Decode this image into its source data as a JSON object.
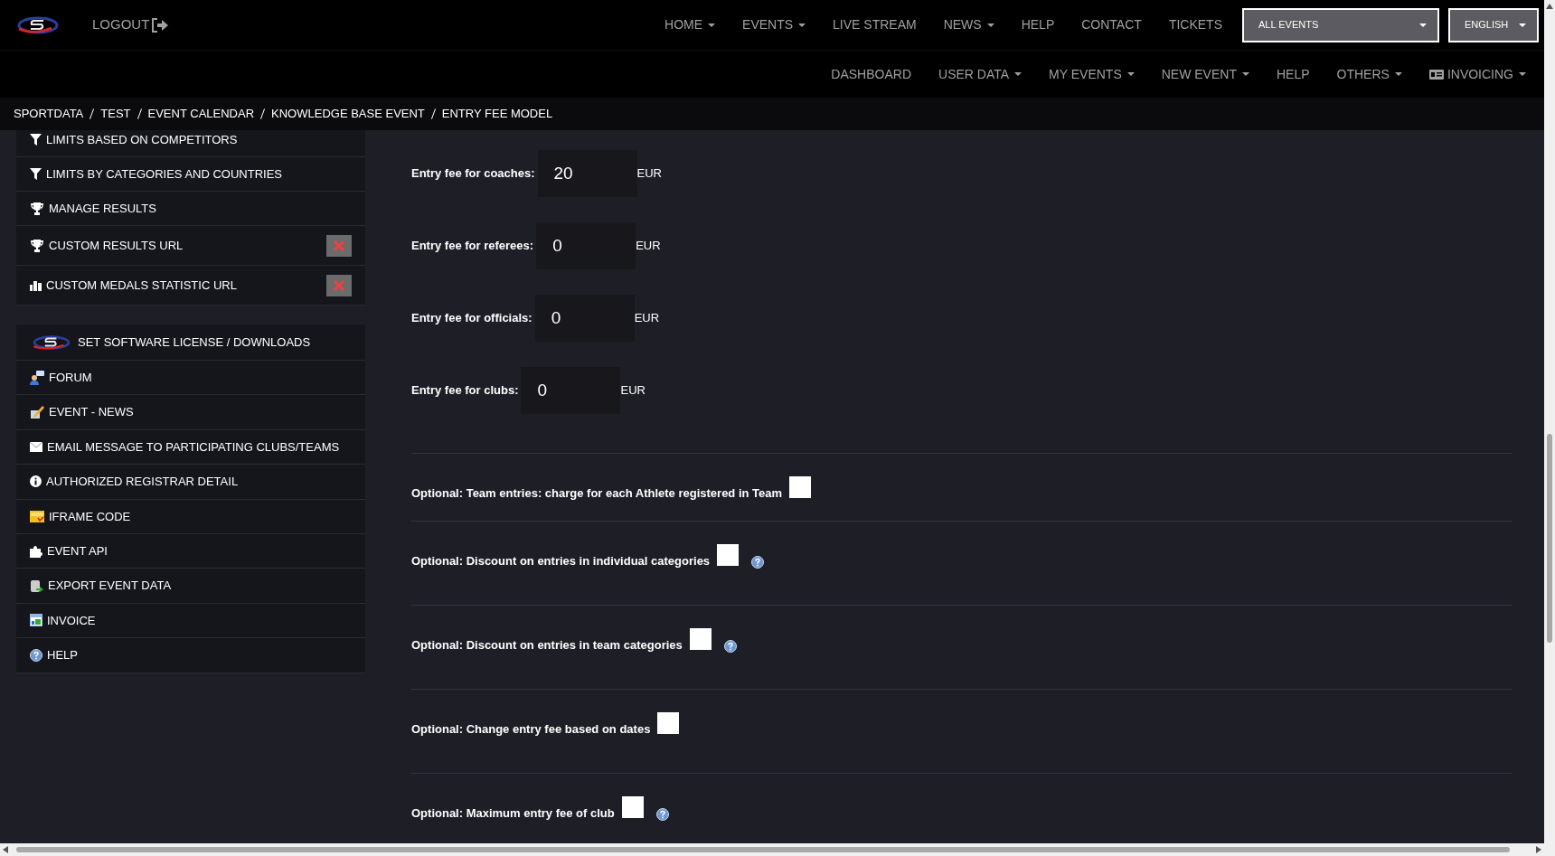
{
  "header": {
    "logout": "LOGOUT",
    "nav_primary": [
      {
        "label": "HOME",
        "dropdown": true
      },
      {
        "label": "EVENTS",
        "dropdown": true
      },
      {
        "label": "LIVE STREAM",
        "dropdown": false
      },
      {
        "label": "NEWS",
        "dropdown": true
      },
      {
        "label": "HELP",
        "dropdown": false
      },
      {
        "label": "CONTACT",
        "dropdown": false
      },
      {
        "label": "TICKETS",
        "dropdown": false
      }
    ],
    "event_select": {
      "value": "ALL EVENTS"
    },
    "language_select": {
      "value": "ENGLISH"
    },
    "nav_secondary": [
      {
        "label": "DASHBOARD",
        "dropdown": false
      },
      {
        "label": "USER DATA",
        "dropdown": true
      },
      {
        "label": "MY EVENTS",
        "dropdown": true
      },
      {
        "label": "NEW EVENT",
        "dropdown": true
      },
      {
        "label": "HELP",
        "dropdown": false
      },
      {
        "label": "OTHERS",
        "dropdown": true
      },
      {
        "label": "INVOICING",
        "dropdown": true
      }
    ]
  },
  "breadcrumb": [
    "SPORTDATA",
    "TEST",
    "EVENT CALENDAR",
    "KNOWLEDGE BASE EVENT",
    "ENTRY FEE MODEL"
  ],
  "sidebar": {
    "groups": [
      {
        "items": [
          {
            "label": "LIMITS BASED ON COMPETITORS",
            "kind": "link"
          },
          {
            "label": "LIMITS BY CATEGORIES AND COUNTRIES",
            "kind": "link"
          },
          {
            "label": "MANAGE RESULTS",
            "kind": "link"
          },
          {
            "label": "CUSTOM RESULTS URL",
            "kind": "remove"
          },
          {
            "label": "CUSTOM MEDALS STATISTIC URL",
            "kind": "remove"
          }
        ]
      },
      {
        "items": [
          {
            "label": "SET SOFTWARE LICENSE / DOWNLOADS",
            "kind": "link"
          },
          {
            "label": "FORUM",
            "kind": "link"
          },
          {
            "label": "EVENT - NEWS",
            "kind": "link"
          },
          {
            "label": "EMAIL MESSAGE TO PARTICIPATING CLUBS/TEAMS",
            "kind": "link"
          },
          {
            "label": "AUTHORIZED REGISTRAR DETAIL",
            "kind": "link"
          },
          {
            "label": "IFRAME CODE",
            "kind": "link"
          },
          {
            "label": "EVENT API",
            "kind": "link"
          },
          {
            "label": "EXPORT EVENT DATA",
            "kind": "link"
          },
          {
            "label": "INVOICE",
            "kind": "link"
          },
          {
            "label": "HELP",
            "kind": "link"
          }
        ]
      }
    ]
  },
  "fees": [
    {
      "label": "Entry fee for coaches:",
      "value": "20",
      "unit": "EUR"
    },
    {
      "label": "Entry fee for referees:",
      "value": "0",
      "unit": "EUR"
    },
    {
      "label": "Entry fee for officials:",
      "value": "0",
      "unit": "EUR"
    },
    {
      "label": "Entry fee for clubs:",
      "value": "0",
      "unit": "EUR"
    }
  ],
  "options": [
    {
      "label": "Optional: Team entries: charge for each Athlete registered in Team",
      "checked": false,
      "help": false
    },
    {
      "label": "Optional: Discount on entries in individual categories",
      "checked": false,
      "help": true
    },
    {
      "label": "Optional: Discount on entries in team categories",
      "checked": false,
      "help": true
    },
    {
      "label": "Optional: Change entry fee based on dates",
      "checked": false,
      "help": false
    },
    {
      "label": "Optional: Maximum entry fee of club",
      "checked": false,
      "help": true
    }
  ]
}
